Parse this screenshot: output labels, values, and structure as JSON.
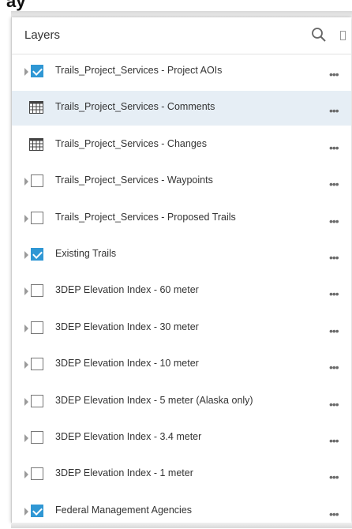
{
  "app": {
    "title": "ay"
  },
  "panel": {
    "title": "Layers",
    "more_glyph": "•••",
    "layers": [
      {
        "label": "Trails_Project_Services - Project AOIs",
        "kind": "group",
        "checked": true,
        "selected": false
      },
      {
        "label": "Trails_Project_Services - Comments",
        "kind": "table",
        "checked": false,
        "selected": true
      },
      {
        "label": "Trails_Project_Services - Changes",
        "kind": "table",
        "checked": false,
        "selected": false
      },
      {
        "label": "Trails_Project_Services - Waypoints",
        "kind": "group",
        "checked": false,
        "selected": false
      },
      {
        "label": "Trails_Project_Services - Proposed Trails",
        "kind": "group",
        "checked": false,
        "selected": false
      },
      {
        "label": "Existing Trails",
        "kind": "group",
        "checked": true,
        "selected": false
      },
      {
        "label": "3DEP Elevation Index - 60 meter",
        "kind": "group",
        "checked": false,
        "selected": false
      },
      {
        "label": "3DEP Elevation Index - 30 meter",
        "kind": "group",
        "checked": false,
        "selected": false
      },
      {
        "label": "3DEP Elevation Index - 10 meter",
        "kind": "group",
        "checked": false,
        "selected": false
      },
      {
        "label": "3DEP Elevation Index - 5 meter (Alaska only)",
        "kind": "group",
        "checked": false,
        "selected": false
      },
      {
        "label": "3DEP Elevation Index - 3.4 meter",
        "kind": "group",
        "checked": false,
        "selected": false
      },
      {
        "label": "3DEP Elevation Index - 1 meter",
        "kind": "group",
        "checked": false,
        "selected": false
      },
      {
        "label": "Federal Management Agencies",
        "kind": "group",
        "checked": true,
        "selected": false
      }
    ]
  },
  "colors": {
    "accent": "#2f97d4",
    "selected_row": "#e6eef5"
  },
  "icons": {
    "search": "search-icon",
    "table": "table-icon",
    "expand": "caret-right-icon",
    "more": "more-options-icon"
  }
}
